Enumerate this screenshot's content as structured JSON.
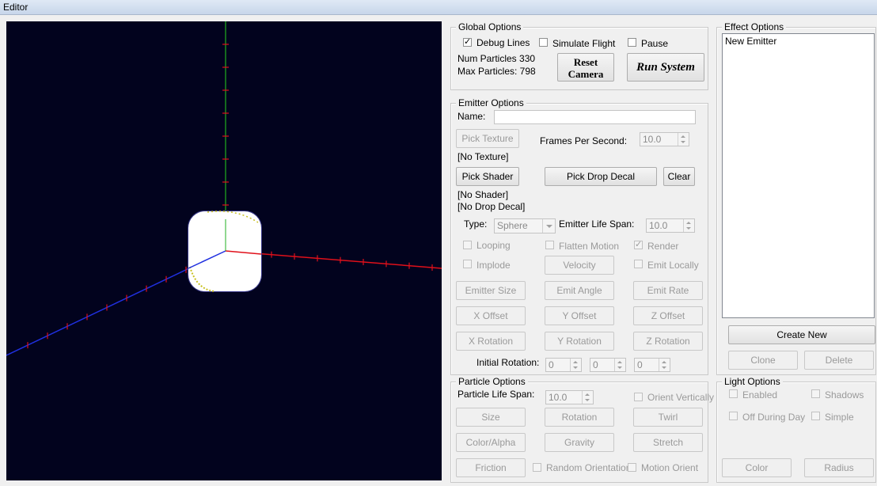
{
  "window": {
    "title": "Editor"
  },
  "global_options": {
    "title": "Global Options",
    "debug_lines": {
      "label": "Debug Lines",
      "checked": true
    },
    "simulate_flight": {
      "label": "Simulate Flight",
      "checked": false
    },
    "pause": {
      "label": "Pause",
      "checked": false
    },
    "num_particles": "Num Particles 330",
    "max_particles": "Max Particles: 798",
    "reset_camera_line1": "Reset",
    "reset_camera_line2": "Camera",
    "run_system": "Run System"
  },
  "emitter_options": {
    "title": "Emitter Options",
    "name_label": "Name:",
    "name_value": "",
    "pick_texture": "Pick Texture",
    "fps_label": "Frames Per Second:",
    "fps_value": "10.0",
    "texture_status": "[No Texture]",
    "pick_shader": "Pick Shader",
    "pick_drop_decal": "Pick Drop Decal",
    "clear": "Clear",
    "shader_status": "[No Shader]",
    "drop_decal_status": "[No Drop Decal]",
    "type_label": "Type:",
    "type_value": "Sphere",
    "life_span_label": "Emitter Life Span:",
    "life_span_value": "10.0",
    "looping": {
      "label": "Looping",
      "checked": false
    },
    "flatten_motion": {
      "label": "Flatten Motion",
      "checked": false
    },
    "render": {
      "label": "Render",
      "checked": true
    },
    "implode": {
      "label": "Implode",
      "checked": false
    },
    "velocity": "Velocity",
    "emit_locally": {
      "label": "Emit Locally",
      "checked": false
    },
    "emitter_size": "Emitter Size",
    "emit_angle": "Emit Angle",
    "emit_rate": "Emit Rate",
    "x_offset": "X Offset",
    "y_offset": "Y Offset",
    "z_offset": "Z Offset",
    "x_rotation": "X Rotation",
    "y_rotation": "Y Rotation",
    "z_rotation": "Z Rotation",
    "initial_rotation_label": "Initial Rotation:",
    "initial_rotation_x": "0",
    "initial_rotation_y": "0",
    "initial_rotation_z": "0"
  },
  "particle_options": {
    "title": "Particle Options",
    "life_span_label": "Particle Life Span:",
    "life_span_value": "10.0",
    "orient_vertically": {
      "label": "Orient Vertically",
      "checked": false
    },
    "size": "Size",
    "rotation": "Rotation",
    "twirl": "Twirl",
    "color_alpha": "Color/Alpha",
    "gravity": "Gravity",
    "stretch": "Stretch",
    "friction": "Friction",
    "random_orientation": {
      "label": "Random Orientation",
      "checked": false
    },
    "motion_orient": {
      "label": "Motion Orient",
      "checked": false
    }
  },
  "effect_options": {
    "title": "Effect Options",
    "emitters": [
      "New Emitter"
    ],
    "create_new": "Create New",
    "clone": "Clone",
    "delete": "Delete"
  },
  "light_options": {
    "title": "Light Options",
    "enabled": {
      "label": "Enabled",
      "checked": false
    },
    "shadows": {
      "label": "Shadows",
      "checked": false
    },
    "off_during_day": {
      "label": "Off During Day",
      "checked": false
    },
    "simple": {
      "label": "Simple",
      "checked": false
    },
    "color": "Color",
    "radius": "Radius"
  },
  "colors": {
    "viewport_bg": "#02031e",
    "axis_x": "#e0101a",
    "axis_y": "#20b020",
    "axis_z": "#2030e0",
    "particles": "#ffffff"
  }
}
